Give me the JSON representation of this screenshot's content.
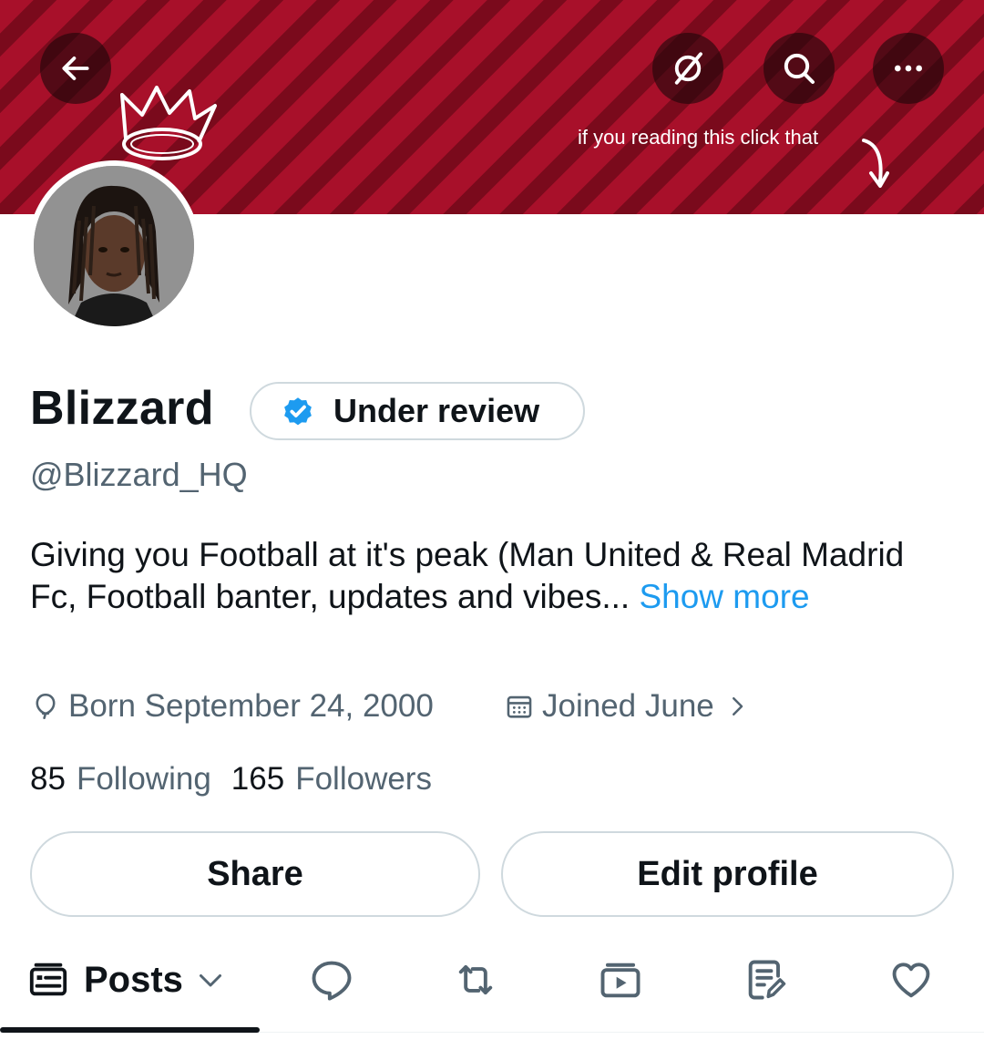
{
  "banner": {
    "note": "if you reading this click that",
    "bg_color": "#a8102a"
  },
  "toolbar": {
    "back_icon": "arrow-left-icon",
    "grok_icon": "grok-slash-icon",
    "search_icon": "search-icon",
    "more_icon": "more-horizontal-icon"
  },
  "profile": {
    "name": "Blizzard",
    "badge_label": "Under review",
    "handle": "@Blizzard_HQ",
    "bio": "Giving you Football at it's peak (Man United & Real Madrid Fc, Football banter, updates and vibes...",
    "bio_more": "Show more",
    "born": "Born September 24, 2000",
    "joined": "Joined June",
    "following_count": "85",
    "following_label": "Following",
    "followers_count": "165",
    "followers_label": "Followers",
    "accent_color": "#1d9bf0"
  },
  "actions": {
    "share_label": "Share",
    "edit_label": "Edit profile"
  },
  "tabs": {
    "posts_label": "Posts"
  }
}
